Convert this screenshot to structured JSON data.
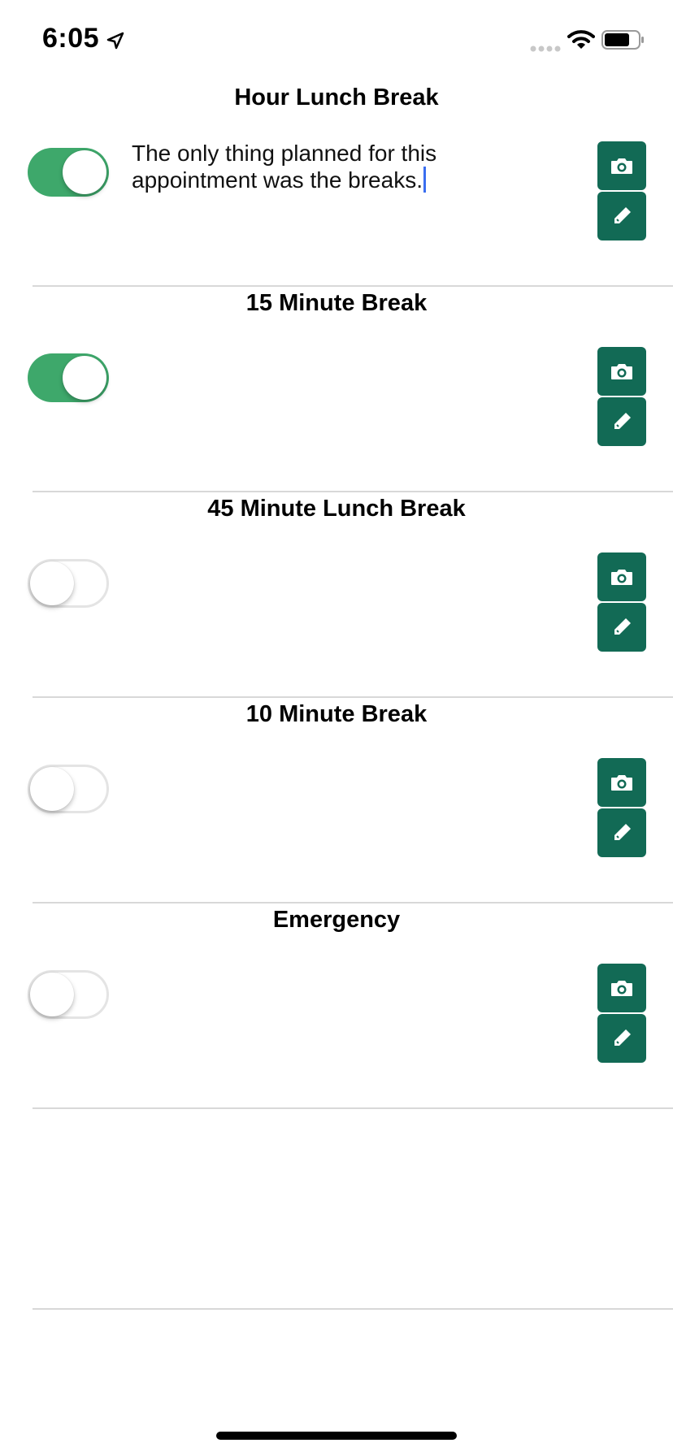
{
  "status_bar": {
    "time": "6:05"
  },
  "rows": [
    {
      "title": "Hour Lunch Break",
      "enabled": true,
      "note": "The only thing planned for this appointment was the breaks.",
      "camera_icon": "camera-icon",
      "edit_icon": "pencil-icon"
    },
    {
      "title": "15 Minute Break",
      "enabled": true,
      "note": "",
      "camera_icon": "camera-icon",
      "edit_icon": "pencil-icon"
    },
    {
      "title": "45 Minute Lunch Break",
      "enabled": false,
      "note": "",
      "camera_icon": "camera-icon",
      "edit_icon": "pencil-icon"
    },
    {
      "title": "10 Minute Break",
      "enabled": false,
      "note": "",
      "camera_icon": "camera-icon",
      "edit_icon": "pencil-icon"
    },
    {
      "title": "Emergency",
      "enabled": false,
      "note": "",
      "camera_icon": "camera-icon",
      "edit_icon": "pencil-icon"
    }
  ],
  "colors": {
    "toggle_on": "#3ea86b",
    "action_button": "#126a55",
    "cursor": "#3a6ef0",
    "divider": "#d8d8d8"
  }
}
